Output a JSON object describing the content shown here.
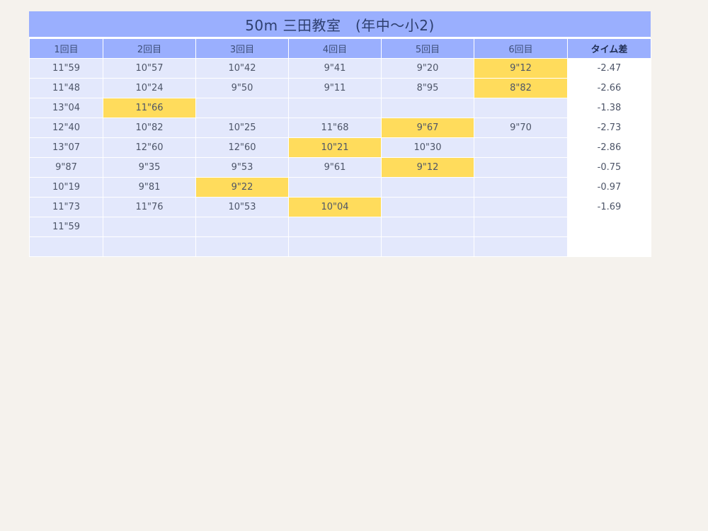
{
  "title": "50m 三田教室　(年中〜小2)",
  "headers": [
    "1回目",
    "2回目",
    "3回目",
    "4回目",
    "5回目",
    "6回目",
    "タイム差"
  ],
  "rows": [
    {
      "times": [
        "11\"59",
        "10\"57",
        "10\"42",
        "9\"41",
        "9\"20",
        "9\"12"
      ],
      "diff": "-2.47",
      "best": 5
    },
    {
      "times": [
        "11\"48",
        "10\"24",
        "9\"50",
        "9\"11",
        "8\"95",
        "8\"82"
      ],
      "diff": "-2.66",
      "best": 5
    },
    {
      "times": [
        "13\"04",
        "11\"66",
        "",
        "",
        "",
        ""
      ],
      "diff": "-1.38",
      "best": 1
    },
    {
      "times": [
        "12\"40",
        "10\"82",
        "10\"25",
        "11\"68",
        "9\"67",
        "9\"70"
      ],
      "diff": "-2.73",
      "best": 4
    },
    {
      "times": [
        "13\"07",
        "12\"60",
        "12\"60",
        "10\"21",
        "10\"30",
        ""
      ],
      "diff": "-2.86",
      "best": 3
    },
    {
      "times": [
        "9\"87",
        "9\"35",
        "9\"53",
        "9\"61",
        "9\"12",
        ""
      ],
      "diff": "-0.75",
      "best": 4
    },
    {
      "times": [
        "10\"19",
        "9\"81",
        "9\"22",
        "",
        "",
        ""
      ],
      "diff": "-0.97",
      "best": 2
    },
    {
      "times": [
        "11\"73",
        "11\"76",
        "10\"53",
        "10\"04",
        "",
        ""
      ],
      "diff": "-1.69",
      "best": 3
    },
    {
      "times": [
        "11\"59",
        "",
        "",
        "",
        "",
        ""
      ],
      "diff": "",
      "best": -1
    },
    {
      "times": [
        "",
        "",
        "",
        "",
        "",
        ""
      ],
      "diff": "",
      "best": -1
    }
  ],
  "colors": {
    "header_bg": "#9aaffe",
    "cell_bg": "#e3e8fc",
    "best_bg": "#ffdc5c",
    "diff_bg": "#ffffff",
    "page_bg": "#f5f2ed"
  }
}
